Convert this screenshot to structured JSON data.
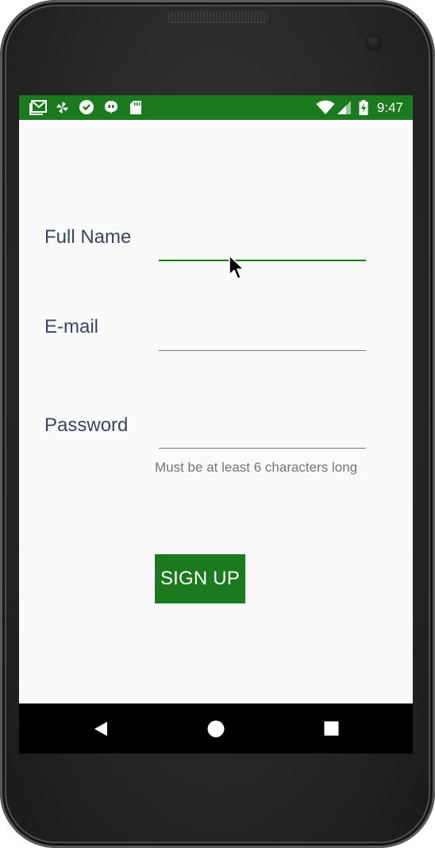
{
  "colors": {
    "accent": "#1b7a1e",
    "label_text": "#3b4560",
    "helper_text": "#757575",
    "screen_bg": "#fafafa",
    "nav_bg": "#000000"
  },
  "status_bar": {
    "time": "9:47",
    "left_icons": [
      "gmail-icon",
      "pinwheel-icon",
      "hangouts-icon",
      "chat-quote-icon",
      "sd-card-icon"
    ],
    "right_icons": [
      "wifi-icon",
      "signal-icon",
      "battery-charging-icon"
    ]
  },
  "form": {
    "full_name": {
      "label": "Full Name",
      "value": "",
      "focused": true
    },
    "email": {
      "label": "E-mail",
      "value": ""
    },
    "password": {
      "label": "Password",
      "value": "",
      "helper": "Must be at least 6 characters long"
    },
    "submit_label": "SIGN UP"
  },
  "nav_bar": {
    "buttons": [
      "back-icon",
      "home-icon",
      "recents-icon"
    ]
  }
}
